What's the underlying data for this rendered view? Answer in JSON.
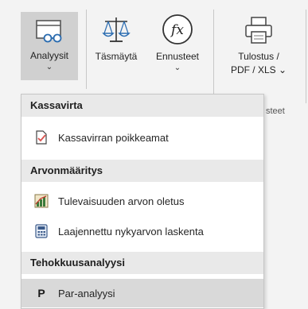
{
  "ribbon": {
    "analyysit": {
      "label": "Analyysit",
      "chevron": "⌄",
      "icon": "glasses-window-icon"
    },
    "tasmayta": {
      "label": "Täsmäytä",
      "icon": "balance-scale-icon"
    },
    "ennusteet": {
      "label": "Ennusteet",
      "chevron": "⌄",
      "icon": "function-icon"
    },
    "tulostus": {
      "label_line1": "Tulostus /",
      "label_line2": "PDF / XLS",
      "chevron": "⌄",
      "icon": "printer-icon"
    },
    "group_label_partial": "steet"
  },
  "menu": {
    "sections": [
      {
        "header": "Kassavirta",
        "items": [
          {
            "label": "Kassavirran poikkeamat",
            "icon": "document-check-icon"
          }
        ]
      },
      {
        "header": "Arvonmääritys",
        "items": [
          {
            "label": "Tulevaisuuden arvon oletus",
            "icon": "chart-icon"
          },
          {
            "label": "Laajennettu nykyarvon laskenta",
            "icon": "calculator-icon"
          }
        ]
      },
      {
        "header": "Tehokkuusanalyysi",
        "items": [
          {
            "label": "Par-analyysi",
            "icon": "p-icon",
            "icon_text": "P"
          }
        ]
      }
    ]
  },
  "colors": {
    "accent_blue": "#2b6cb0",
    "selected_bg": "#d0d0d0",
    "header_bg": "#e9e9e9",
    "hover_bg": "#d9d9d9"
  }
}
